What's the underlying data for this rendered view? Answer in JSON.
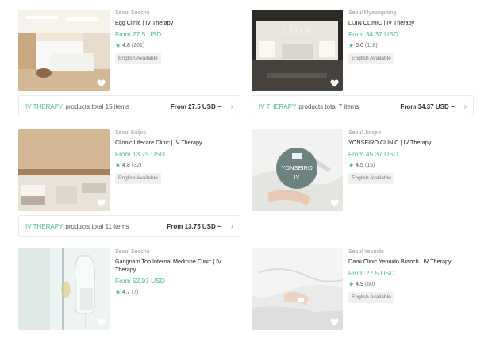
{
  "listings": [
    {
      "location": "Seoul Seocho",
      "name": "Egg Clinic | IV Therapy",
      "price": "From 27.5 USD",
      "rating": "4.8",
      "reviews": "(261)",
      "badge": "English Available"
    },
    {
      "location": "Seoul Myeongdong",
      "name": "LIJIN CLINIC | IV Therapy",
      "price": "From 34.37 USD",
      "rating": "5.0",
      "reviews": "(118)",
      "badge": "English Available",
      "sign": "LIJIN"
    },
    {
      "location": "Seoul Euljiro",
      "name": "Clionic Lifecare Clinic | IV Therapy",
      "price": "From 13.75 USD",
      "rating": "4.8",
      "reviews": "(32)",
      "badge": "English Available"
    },
    {
      "location": "Seoul Jongro",
      "name": "YONSEIRO CLINIC | IV Therapy",
      "price": "From 45.37 USD",
      "rating": "4.5",
      "reviews": "(15)",
      "badge": "English Available",
      "logo_line1": "YONSEIRO",
      "logo_line2": "IV"
    },
    {
      "location": "Seoul Seocho",
      "name": "Gangnam Top Internal Medicine Clinic | IV Therapy",
      "price": "From 52.93 USD",
      "rating": "4.7",
      "reviews": "(7)"
    },
    {
      "location": "Seoul Yeouido",
      "name": "Dami Clinic Yeouido Branch | IV Therapy",
      "price": "From 27.5 USD",
      "rating": "4.9",
      "reviews": "(60)",
      "badge": "English Available"
    }
  ],
  "summaries": [
    {
      "category": "IV THERAPY",
      "text": "products total 15 items",
      "from": "From 27.5 USD ~"
    },
    {
      "category": "IV THERAPY",
      "text": "products total 7 items",
      "from": "From 34.37 USD ~"
    },
    {
      "category": "IV THERAPY",
      "text": "products total 11 items",
      "from": "From 13.75 USD ~"
    }
  ],
  "icons": {
    "star": "star-icon",
    "heart": "heart-icon",
    "chevron": "chevron-right-icon"
  },
  "colors": {
    "accent": "#4fb89a",
    "text": "#222222",
    "muted": "#9a9a9a",
    "badge_bg": "#eef0f1"
  }
}
